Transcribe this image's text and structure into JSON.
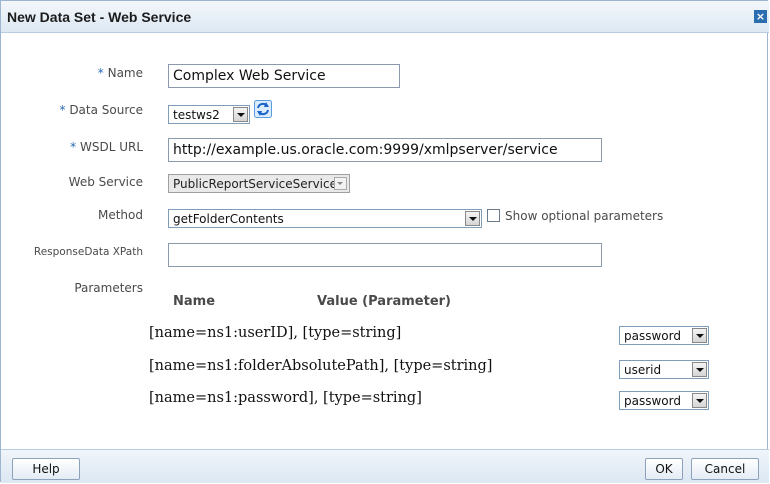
{
  "dialog": {
    "title": "New Data Set - Web Service",
    "close_glyph": "×"
  },
  "form": {
    "required_marker": "*",
    "name": {
      "label": "Name",
      "value": "Complex Web Service"
    },
    "data_source": {
      "label": "Data Source",
      "value": "testws2",
      "icon": "refresh-icon"
    },
    "wsdl_url": {
      "label": "WSDL URL",
      "value": "http://example.us.oracle.com:9999/xmlpserver/service"
    },
    "web_service": {
      "label": "Web Service",
      "value": "PublicReportServiceService"
    },
    "method": {
      "label": "Method",
      "value": "getFolderContents",
      "optional_label": "Show optional parameters",
      "optional_checked": false
    },
    "response_xpath": {
      "label": "ResponseData XPath",
      "value": ""
    },
    "parameters": {
      "label": "Parameters",
      "col_name": "Name",
      "col_value": "Value (Parameter)",
      "rows": [
        {
          "name": "[name=ns1:userID], [type=string]",
          "value": "password"
        },
        {
          "name": "[name=ns1:folderAbsolutePath], [type=string]",
          "value": "userid"
        },
        {
          "name": "[name=ns1:password], [type=string]",
          "value": "password"
        }
      ]
    }
  },
  "footer": {
    "help": "Help",
    "ok": "OK",
    "cancel": "Cancel"
  },
  "colors": {
    "accent": "#2569b3",
    "titlebar": "#dde8f3",
    "border": "#9db5cf"
  }
}
